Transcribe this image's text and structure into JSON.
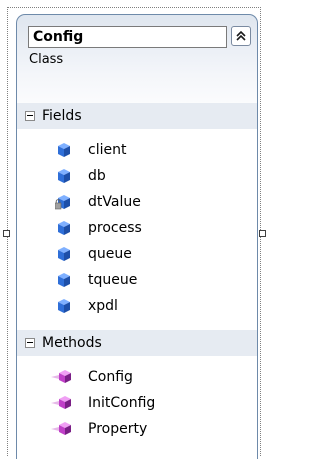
{
  "class_shape": {
    "name": "Config",
    "stereotype": "Class",
    "collapse_icon": "chevron-double-up-icon"
  },
  "fields": {
    "header": "Fields",
    "toggle_icon": "collapse-minus-icon",
    "items": [
      {
        "name": "client",
        "icon": "field-icon",
        "visibility": "public"
      },
      {
        "name": "db",
        "icon": "field-icon",
        "visibility": "public"
      },
      {
        "name": "dtValue",
        "icon": "private-field-icon",
        "visibility": "private"
      },
      {
        "name": "process",
        "icon": "field-icon",
        "visibility": "public"
      },
      {
        "name": "queue",
        "icon": "field-icon",
        "visibility": "public"
      },
      {
        "name": "tqueue",
        "icon": "field-icon",
        "visibility": "public"
      },
      {
        "name": "xpdl",
        "icon": "field-icon",
        "visibility": "public"
      }
    ]
  },
  "methods": {
    "header": "Methods",
    "toggle_icon": "collapse-minus-icon",
    "items": [
      {
        "name": "Config",
        "icon": "method-icon"
      },
      {
        "name": "InitConfig",
        "icon": "method-icon"
      },
      {
        "name": "Property",
        "icon": "method-icon"
      }
    ]
  },
  "colors": {
    "field_icon": "#2f6fd8",
    "method_icon": "#c040c8",
    "border": "#6e8aaa",
    "header_band": "#e6ebf2"
  }
}
